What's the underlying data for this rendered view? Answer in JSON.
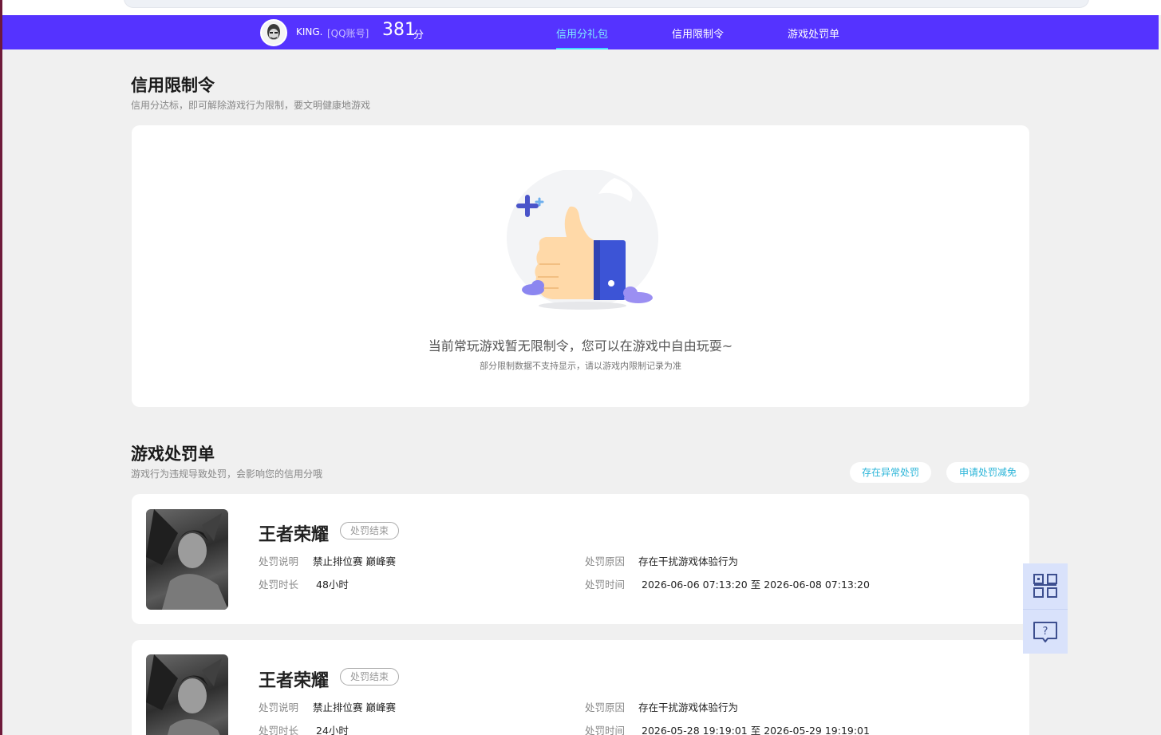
{
  "user": {
    "nickname": "KING.",
    "account_type": "[QQ账号]",
    "score": "381",
    "score_unit": "分"
  },
  "nav": {
    "tabs": [
      {
        "label": "信用分礼包",
        "active": true
      },
      {
        "label": "信用限制令",
        "active": false
      },
      {
        "label": "游戏处罚单",
        "active": false
      }
    ]
  },
  "restriction": {
    "title": "信用限制令",
    "subtitle": "信用分达标，即可解除游戏行为限制，要文明健康地游戏",
    "empty_main": "当前常玩游戏暂无限制令，您可以在游戏中自由玩耍~",
    "empty_sub": "部分限制数据不支持显示，请以游戏内限制记录为准"
  },
  "penalty": {
    "title": "游戏处罚单",
    "subtitle": "游戏行为违规导致处罚，会影响您的信用分哦",
    "buttons": {
      "abnormal": "存在异常处罚",
      "appeal": "申请处罚减免"
    },
    "labels": {
      "desc": "处罚说明",
      "duration": "处罚时长",
      "reason": "处罚原因",
      "time": "处罚时间"
    },
    "items": [
      {
        "game": "王者荣耀",
        "status": "处罚结束",
        "desc": "禁止排位赛 巅峰赛",
        "duration": "48小时",
        "reason": "存在干扰游戏体验行为",
        "time": "2026-06-06 07:13:20 至 2026-06-08 07:13:20"
      },
      {
        "game": "王者荣耀",
        "status": "处罚结束",
        "desc": "禁止排位赛 巅峰赛",
        "duration": "24小时",
        "reason": "存在干扰游戏体验行为",
        "time": "2026-05-28 19:19:01 至 2026-05-29 19:19:01"
      }
    ]
  },
  "side": {
    "qr": "qr-code-icon",
    "help": "help-chat-icon"
  },
  "colors": {
    "nav": "#5533ff",
    "active_tab": "#7ee8ff",
    "accent": "#29b4d8"
  }
}
